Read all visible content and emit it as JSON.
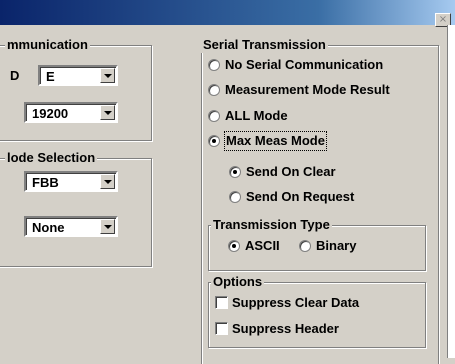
{
  "window": {
    "close_glyph": "×"
  },
  "communication": {
    "title": "mmunication",
    "parity_label": "D",
    "parity_value": "E",
    "baud_value": "19200"
  },
  "mode_selection": {
    "title": "lode Selection",
    "mode_value": "FBB",
    "second_value": "None"
  },
  "serial_transmission": {
    "title": "Serial Transmission",
    "options": [
      {
        "label": "No Serial Communication",
        "checked": false
      },
      {
        "label": "Measurement Mode Result",
        "checked": false
      },
      {
        "label": "ALL Mode",
        "checked": false
      },
      {
        "label": "Max Meas Mode",
        "checked": true
      }
    ],
    "sub_options": [
      {
        "label": "Send On Clear",
        "checked": true
      },
      {
        "label": "Send On Request",
        "checked": false
      }
    ]
  },
  "transmission_type": {
    "title": "Transmission Type",
    "options": [
      {
        "label": "ASCII",
        "checked": true
      },
      {
        "label": "Binary",
        "checked": false
      }
    ]
  },
  "options_group": {
    "title": "Options",
    "checkboxes": [
      {
        "label": "Suppress Clear Data",
        "checked": false
      },
      {
        "label": "Suppress Header",
        "checked": false
      }
    ]
  },
  "colors": {
    "titlebar": "#0a246a",
    "face": "#d4d0c8"
  }
}
